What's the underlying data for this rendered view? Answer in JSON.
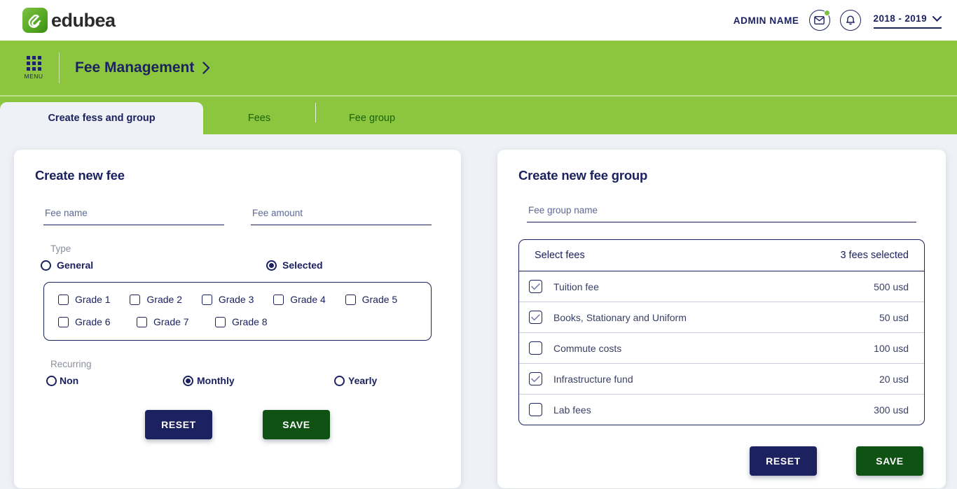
{
  "topbar": {
    "brand_name": "edubea",
    "brand_logo_icon": "edubea-paperclip-logo",
    "admin_name": "ADMIN NAME",
    "mail_icon": "envelope-icon",
    "mail_badge": "new-message-dot",
    "notification_icon": "bell-icon",
    "year_value": "2018 - 2019",
    "year_caret_icon": "chevron-down-icon"
  },
  "header": {
    "menu_icon": "grid-menu-icon",
    "menu_label": "MENU",
    "title": "Fee Management",
    "title_caret_icon": "chevron-right-icon"
  },
  "tabs": [
    {
      "label": "Create fess and group",
      "active": true
    },
    {
      "label": "Fees",
      "active": false
    },
    {
      "label": "Fee group",
      "active": false
    }
  ],
  "create_fee": {
    "title": "Create new fee",
    "fee_name": {
      "placeholder": "Fee name",
      "value": ""
    },
    "fee_amount": {
      "placeholder": "Fee amount",
      "value": ""
    },
    "type_label": "Type",
    "type_options": [
      {
        "label": "General",
        "checked": false
      },
      {
        "label": "Selected",
        "checked": true
      }
    ],
    "grades": [
      {
        "label": "Grade 1",
        "checked": false
      },
      {
        "label": "Grade 2",
        "checked": false
      },
      {
        "label": "Grade 3",
        "checked": false
      },
      {
        "label": "Grade 4",
        "checked": false
      },
      {
        "label": "Grade 5",
        "checked": false
      },
      {
        "label": "Grade 6",
        "checked": false
      },
      {
        "label": "Grade 7",
        "checked": false
      },
      {
        "label": "Grade 8",
        "checked": false
      }
    ],
    "recurring_label": "Recurring",
    "recurring_options": [
      {
        "label": "Non",
        "checked": false
      },
      {
        "label": "Monthly",
        "checked": true
      },
      {
        "label": "Yearly",
        "checked": false
      }
    ],
    "reset_label": "RESET",
    "save_label": "SAVE"
  },
  "create_fee_group": {
    "title": "Create new fee group",
    "group_name": {
      "placeholder": "Fee group name",
      "value": ""
    },
    "select_fees_label": "Select fees",
    "selected_count_label": "3 fees selected",
    "fees": [
      {
        "name": "Tuition fee",
        "amount": "500 usd",
        "checked": true
      },
      {
        "name": "Books, Stationary and Uniform",
        "amount": "50 usd",
        "checked": true
      },
      {
        "name": "Commute costs",
        "amount": "100 usd",
        "checked": false
      },
      {
        "name": "Infrastructure fund",
        "amount": "20 usd",
        "checked": true
      },
      {
        "name": "Lab fees",
        "amount": "300 usd",
        "checked": false
      }
    ],
    "reset_label": "RESET",
    "save_label": "SAVE"
  },
  "colors": {
    "brand_green": "#8cc63e",
    "navy": "#1c2260",
    "save_green": "#0f5213",
    "page_bg": "#eef1f5"
  }
}
